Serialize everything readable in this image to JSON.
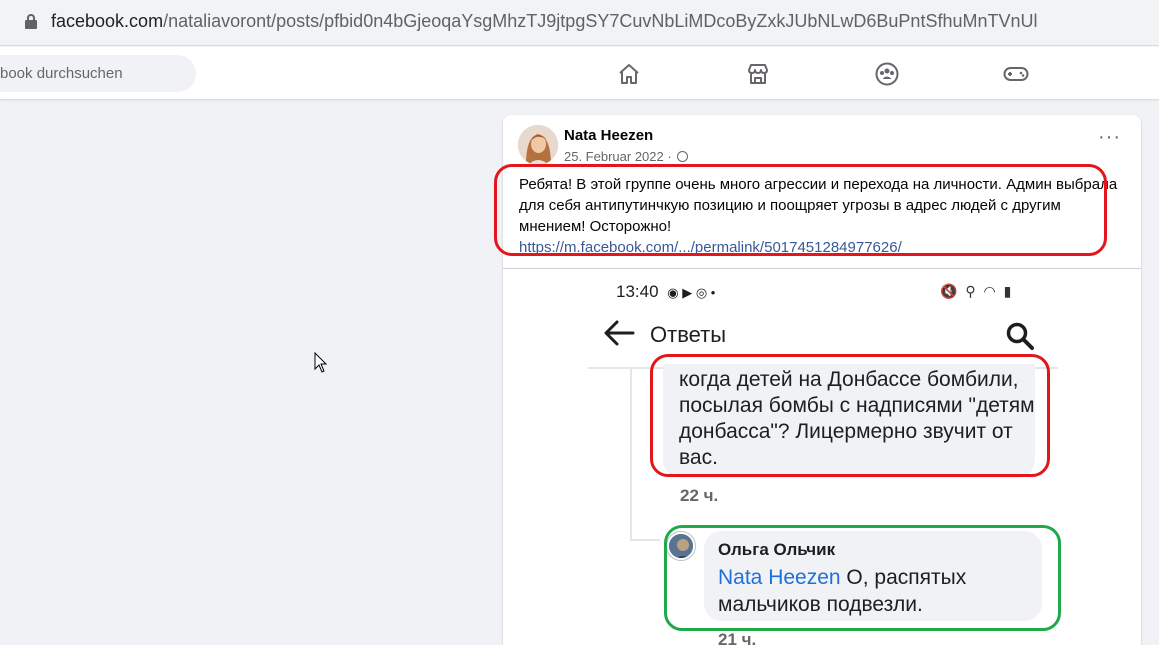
{
  "browser": {
    "url_host": "facebook.com",
    "url_path": "/nataliavoront/posts/pfbid0n4bGjeoqaYsgMhzTJ9jtpgSY7CuvNbLiMDcoByZxkJUbNLwD6BuPntSfhuMnTVnUl"
  },
  "fb_nav": {
    "search_placeholder": "book durchsuchen",
    "icons": [
      "home-icon",
      "marketplace-icon",
      "groups-icon",
      "gaming-icon"
    ]
  },
  "post": {
    "author": "Nata Heezen",
    "date": "25. Februar 2022 ·",
    "more": "···",
    "text": "Ребята! В этой группе очень много агрессии и перехода на личности. Админ выбрала для себя антипутинчкую позицию и поощряет угрозы в адрес людей с другим мнением! Осторожно!",
    "link": "https://m.facebook.com/.../permalink/5017451284977626/"
  },
  "embedded": {
    "status_time": "13:40",
    "status_left_icons": "◉ ▶ ◎ •",
    "status_right_icons": "🔇 ⚲ ◠ ▮",
    "title": "Ответы",
    "comment_text": "когда детей на Донбассе бомбили, посылая бомбы с надписями \"детям донбасса\"? Лицермерно звучит от вас.",
    "comment_time": "22 ч.",
    "reply_author": "Ольга Ольчик",
    "reply_mention": "Nata Heezen",
    "reply_text": " О, распятых мальчиков подвезли.",
    "reply_time": "21 ч."
  },
  "colors": {
    "annotation_red": "#e3161d",
    "annotation_green": "#1ea94a",
    "link": "#385898",
    "mention": "#216fdb"
  }
}
